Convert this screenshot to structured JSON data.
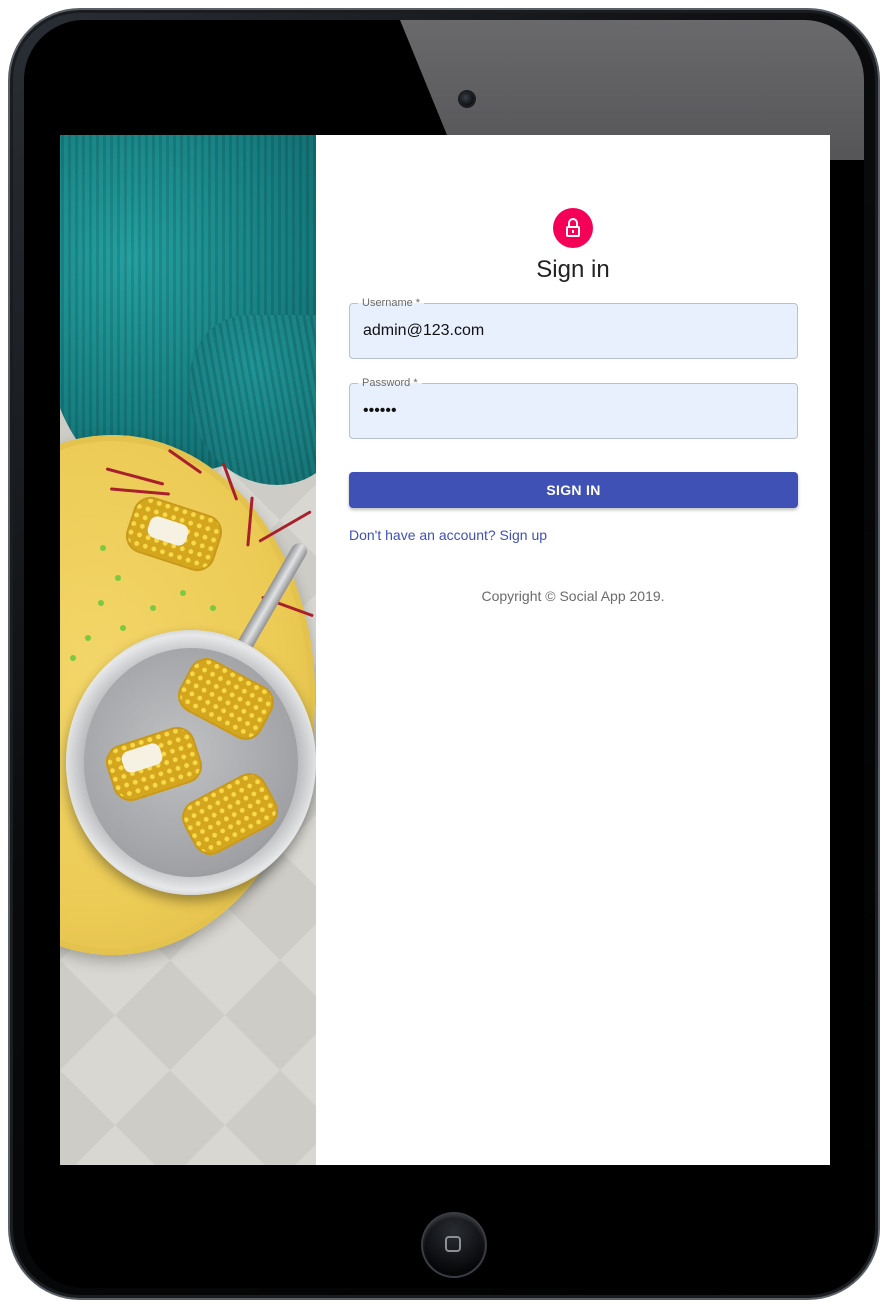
{
  "signin": {
    "title": "Sign in",
    "username": {
      "label": "Username *",
      "value": "admin@123.com"
    },
    "password": {
      "label": "Password *",
      "value": "••••••"
    },
    "submit_label": "SIGN IN",
    "signup_link": "Don't have an account? Sign up",
    "copyright": "Copyright © Social App 2019.",
    "icon": "lock-icon"
  },
  "colors": {
    "accent": "#f50057",
    "primary": "#3f51b5",
    "autofill_bg": "#e8f0fe"
  }
}
